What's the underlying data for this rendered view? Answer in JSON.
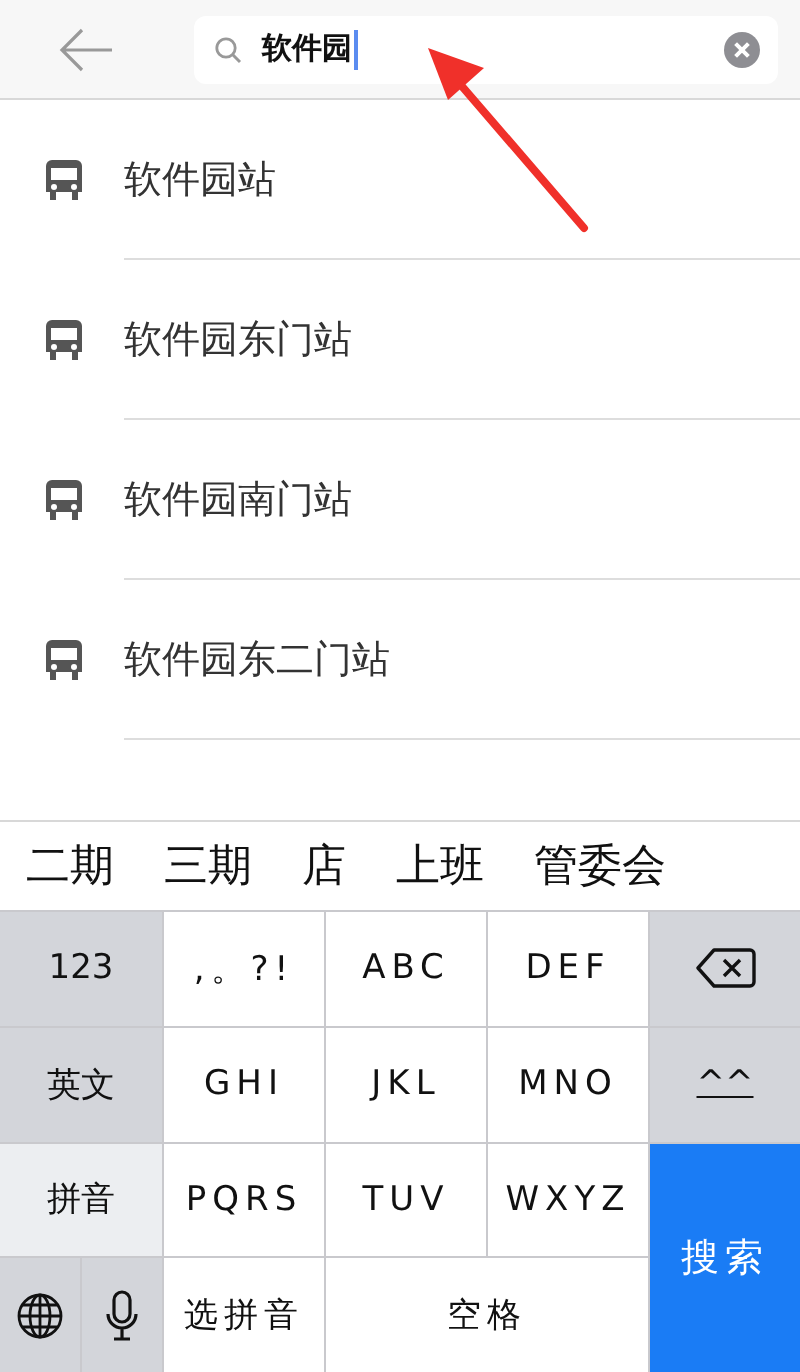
{
  "search": {
    "value": "软件园",
    "focused": true
  },
  "results": [
    {
      "name": "软件园站"
    },
    {
      "name": "软件园东门站"
    },
    {
      "name": "软件园南门站"
    },
    {
      "name": "软件园东二门站"
    }
  ],
  "candidates": [
    "二期",
    "三期",
    "店",
    "上班",
    "管委会"
  ],
  "keyboard": [
    {
      "kind": "mode",
      "label": "123",
      "selected": false
    },
    {
      "kind": "letter",
      "label": ",。?!"
    },
    {
      "kind": "letter",
      "label": "ABC"
    },
    {
      "kind": "letter",
      "label": "DEF"
    },
    {
      "kind": "delete"
    },
    {
      "kind": "mode",
      "label": "英文",
      "selected": false
    },
    {
      "kind": "letter",
      "label": "GHI"
    },
    {
      "kind": "letter",
      "label": "JKL"
    },
    {
      "kind": "letter",
      "label": "MNO"
    },
    {
      "kind": "emoji",
      "label": "^^"
    },
    {
      "kind": "mode",
      "label": "拼音",
      "selected": true
    },
    {
      "kind": "letter",
      "label": "PQRS"
    },
    {
      "kind": "letter",
      "label": "TUV"
    },
    {
      "kind": "letter",
      "label": "WXYZ"
    },
    {
      "kind": "search",
      "label": "搜索"
    },
    {
      "kind": "globe"
    },
    {
      "kind": "mic"
    },
    {
      "kind": "letter",
      "label": "选拼音"
    },
    {
      "kind": "space",
      "label": "空格"
    }
  ]
}
